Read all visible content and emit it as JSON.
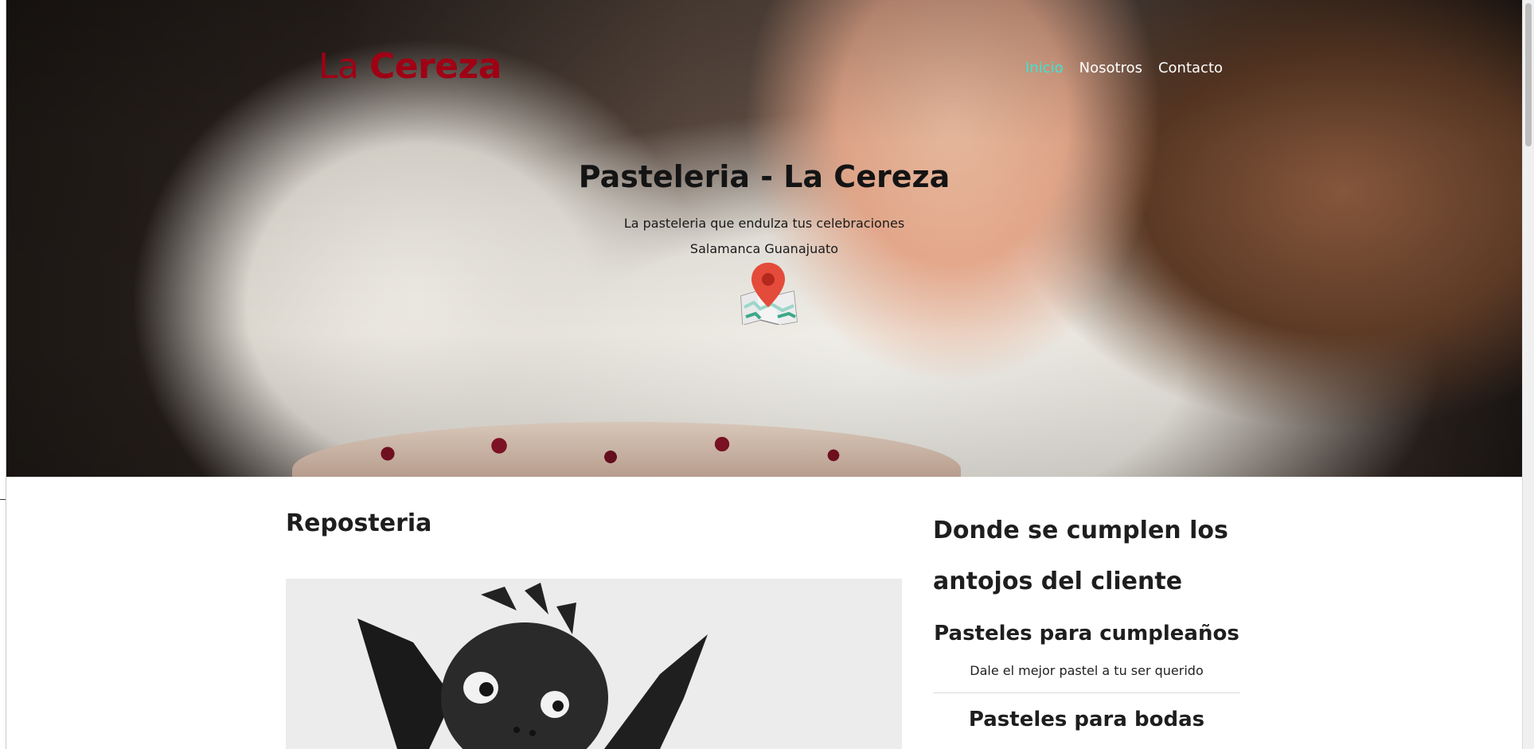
{
  "brand": {
    "part1": "La ",
    "part2": "Cereza",
    "color": "#a00014"
  },
  "nav": {
    "items": [
      "Inicio",
      "Nosotros",
      "Contacto"
    ],
    "active_color": "#39e6d6"
  },
  "hero": {
    "title": "Pasteleria - La Cereza",
    "subtitle": "La pasteleria que endulza tus celebraciones",
    "location": "Salamanca Guanajuato",
    "map_icon": "map-pin-icon"
  },
  "left": {
    "title": "Reposteria"
  },
  "right": {
    "heading": "Donde se cumplen los antojos del cliente",
    "services": [
      {
        "title": "Pasteles para cumpleaños",
        "description": "Dale el mejor pastel a tu ser querido"
      },
      {
        "title": "Pasteles para bodas"
      }
    ]
  }
}
